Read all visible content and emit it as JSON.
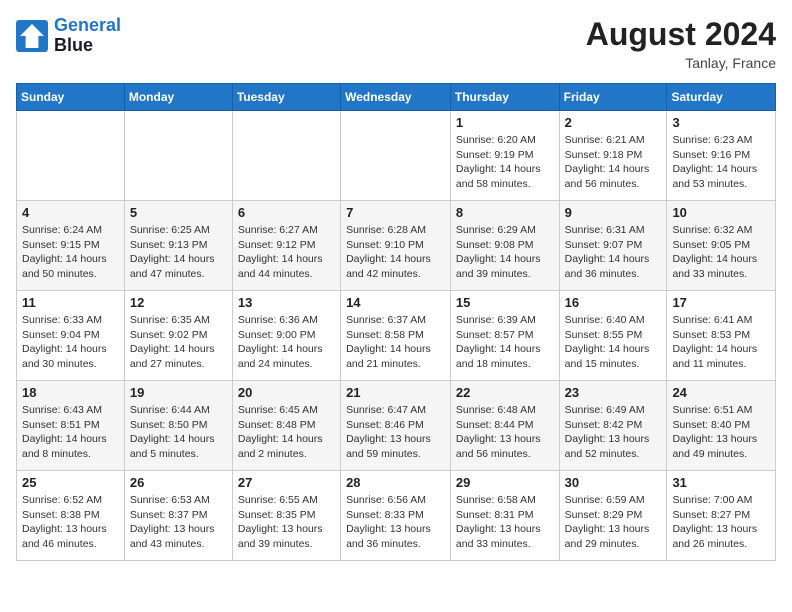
{
  "header": {
    "logo_line1": "General",
    "logo_line2": "Blue",
    "month_year": "August 2024",
    "location": "Tanlay, France"
  },
  "weekdays": [
    "Sunday",
    "Monday",
    "Tuesday",
    "Wednesday",
    "Thursday",
    "Friday",
    "Saturday"
  ],
  "weeks": [
    [
      {
        "day": "",
        "sunrise": "",
        "sunset": "",
        "daylight": ""
      },
      {
        "day": "",
        "sunrise": "",
        "sunset": "",
        "daylight": ""
      },
      {
        "day": "",
        "sunrise": "",
        "sunset": "",
        "daylight": ""
      },
      {
        "day": "",
        "sunrise": "",
        "sunset": "",
        "daylight": ""
      },
      {
        "day": "1",
        "sunrise": "Sunrise: 6:20 AM",
        "sunset": "Sunset: 9:19 PM",
        "daylight": "Daylight: 14 hours and 58 minutes."
      },
      {
        "day": "2",
        "sunrise": "Sunrise: 6:21 AM",
        "sunset": "Sunset: 9:18 PM",
        "daylight": "Daylight: 14 hours and 56 minutes."
      },
      {
        "day": "3",
        "sunrise": "Sunrise: 6:23 AM",
        "sunset": "Sunset: 9:16 PM",
        "daylight": "Daylight: 14 hours and 53 minutes."
      }
    ],
    [
      {
        "day": "4",
        "sunrise": "Sunrise: 6:24 AM",
        "sunset": "Sunset: 9:15 PM",
        "daylight": "Daylight: 14 hours and 50 minutes."
      },
      {
        "day": "5",
        "sunrise": "Sunrise: 6:25 AM",
        "sunset": "Sunset: 9:13 PM",
        "daylight": "Daylight: 14 hours and 47 minutes."
      },
      {
        "day": "6",
        "sunrise": "Sunrise: 6:27 AM",
        "sunset": "Sunset: 9:12 PM",
        "daylight": "Daylight: 14 hours and 44 minutes."
      },
      {
        "day": "7",
        "sunrise": "Sunrise: 6:28 AM",
        "sunset": "Sunset: 9:10 PM",
        "daylight": "Daylight: 14 hours and 42 minutes."
      },
      {
        "day": "8",
        "sunrise": "Sunrise: 6:29 AM",
        "sunset": "Sunset: 9:08 PM",
        "daylight": "Daylight: 14 hours and 39 minutes."
      },
      {
        "day": "9",
        "sunrise": "Sunrise: 6:31 AM",
        "sunset": "Sunset: 9:07 PM",
        "daylight": "Daylight: 14 hours and 36 minutes."
      },
      {
        "day": "10",
        "sunrise": "Sunrise: 6:32 AM",
        "sunset": "Sunset: 9:05 PM",
        "daylight": "Daylight: 14 hours and 33 minutes."
      }
    ],
    [
      {
        "day": "11",
        "sunrise": "Sunrise: 6:33 AM",
        "sunset": "Sunset: 9:04 PM",
        "daylight": "Daylight: 14 hours and 30 minutes."
      },
      {
        "day": "12",
        "sunrise": "Sunrise: 6:35 AM",
        "sunset": "Sunset: 9:02 PM",
        "daylight": "Daylight: 14 hours and 27 minutes."
      },
      {
        "day": "13",
        "sunrise": "Sunrise: 6:36 AM",
        "sunset": "Sunset: 9:00 PM",
        "daylight": "Daylight: 14 hours and 24 minutes."
      },
      {
        "day": "14",
        "sunrise": "Sunrise: 6:37 AM",
        "sunset": "Sunset: 8:58 PM",
        "daylight": "Daylight: 14 hours and 21 minutes."
      },
      {
        "day": "15",
        "sunrise": "Sunrise: 6:39 AM",
        "sunset": "Sunset: 8:57 PM",
        "daylight": "Daylight: 14 hours and 18 minutes."
      },
      {
        "day": "16",
        "sunrise": "Sunrise: 6:40 AM",
        "sunset": "Sunset: 8:55 PM",
        "daylight": "Daylight: 14 hours and 15 minutes."
      },
      {
        "day": "17",
        "sunrise": "Sunrise: 6:41 AM",
        "sunset": "Sunset: 8:53 PM",
        "daylight": "Daylight: 14 hours and 11 minutes."
      }
    ],
    [
      {
        "day": "18",
        "sunrise": "Sunrise: 6:43 AM",
        "sunset": "Sunset: 8:51 PM",
        "daylight": "Daylight: 14 hours and 8 minutes."
      },
      {
        "day": "19",
        "sunrise": "Sunrise: 6:44 AM",
        "sunset": "Sunset: 8:50 PM",
        "daylight": "Daylight: 14 hours and 5 minutes."
      },
      {
        "day": "20",
        "sunrise": "Sunrise: 6:45 AM",
        "sunset": "Sunset: 8:48 PM",
        "daylight": "Daylight: 14 hours and 2 minutes."
      },
      {
        "day": "21",
        "sunrise": "Sunrise: 6:47 AM",
        "sunset": "Sunset: 8:46 PM",
        "daylight": "Daylight: 13 hours and 59 minutes."
      },
      {
        "day": "22",
        "sunrise": "Sunrise: 6:48 AM",
        "sunset": "Sunset: 8:44 PM",
        "daylight": "Daylight: 13 hours and 56 minutes."
      },
      {
        "day": "23",
        "sunrise": "Sunrise: 6:49 AM",
        "sunset": "Sunset: 8:42 PM",
        "daylight": "Daylight: 13 hours and 52 minutes."
      },
      {
        "day": "24",
        "sunrise": "Sunrise: 6:51 AM",
        "sunset": "Sunset: 8:40 PM",
        "daylight": "Daylight: 13 hours and 49 minutes."
      }
    ],
    [
      {
        "day": "25",
        "sunrise": "Sunrise: 6:52 AM",
        "sunset": "Sunset: 8:38 PM",
        "daylight": "Daylight: 13 hours and 46 minutes."
      },
      {
        "day": "26",
        "sunrise": "Sunrise: 6:53 AM",
        "sunset": "Sunset: 8:37 PM",
        "daylight": "Daylight: 13 hours and 43 minutes."
      },
      {
        "day": "27",
        "sunrise": "Sunrise: 6:55 AM",
        "sunset": "Sunset: 8:35 PM",
        "daylight": "Daylight: 13 hours and 39 minutes."
      },
      {
        "day": "28",
        "sunrise": "Sunrise: 6:56 AM",
        "sunset": "Sunset: 8:33 PM",
        "daylight": "Daylight: 13 hours and 36 minutes."
      },
      {
        "day": "29",
        "sunrise": "Sunrise: 6:58 AM",
        "sunset": "Sunset: 8:31 PM",
        "daylight": "Daylight: 13 hours and 33 minutes."
      },
      {
        "day": "30",
        "sunrise": "Sunrise: 6:59 AM",
        "sunset": "Sunset: 8:29 PM",
        "daylight": "Daylight: 13 hours and 29 minutes."
      },
      {
        "day": "31",
        "sunrise": "Sunrise: 7:00 AM",
        "sunset": "Sunset: 8:27 PM",
        "daylight": "Daylight: 13 hours and 26 minutes."
      }
    ]
  ]
}
